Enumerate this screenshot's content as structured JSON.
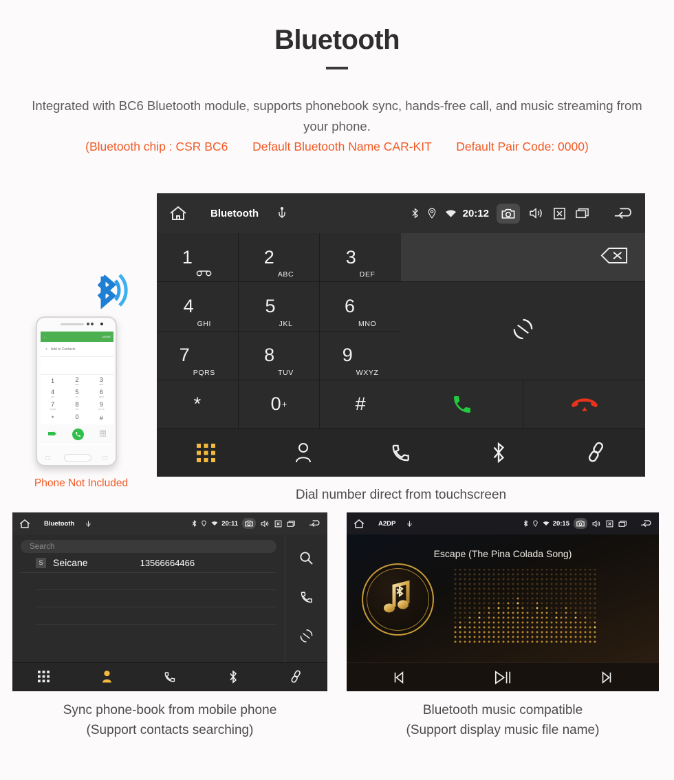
{
  "header": {
    "title": "Bluetooth",
    "description": "Integrated with BC6 Bluetooth module, supports phonebook sync, hands-free call, and music streaming from your phone.",
    "spec_chip": "(Bluetooth chip : CSR BC6",
    "spec_name": "Default Bluetooth Name CAR-KIT",
    "spec_pair": "Default Pair Code: 0000)",
    "accent_color": "#f15a24",
    "text_color": "#5c5c5c"
  },
  "phone_mock": {
    "note": "Phone Not Included",
    "screen": {
      "topbar_more": "MORE",
      "add_contacts": "Add to Contacts",
      "keys": [
        {
          "num": "1",
          "sub": ""
        },
        {
          "num": "2",
          "sub": "ABC"
        },
        {
          "num": "3",
          "sub": "DEF"
        },
        {
          "num": "4",
          "sub": "GHI"
        },
        {
          "num": "5",
          "sub": "JKL"
        },
        {
          "num": "6",
          "sub": "MNO"
        },
        {
          "num": "7",
          "sub": "PQRS"
        },
        {
          "num": "8",
          "sub": "TUV"
        },
        {
          "num": "9",
          "sub": "WXYZ"
        },
        {
          "num": "*",
          "sub": ""
        },
        {
          "num": "0",
          "sub": "+"
        },
        {
          "num": "#",
          "sub": ""
        }
      ]
    }
  },
  "dialer_unit": {
    "statusbar": {
      "home_icon": "home-icon",
      "title": "Bluetooth",
      "usb_icon": "usb-icon",
      "bluetooth_icon": "bluetooth-icon",
      "location_icon": "location-icon",
      "wifi_icon": "wifi-icon",
      "clock": "20:12",
      "camera_icon": "camera-icon",
      "volume_icon": "volume-icon",
      "close_icon": "close-box-icon",
      "recents_icon": "recents-icon",
      "back_icon": "back-icon"
    },
    "keys": [
      {
        "num": "1",
        "sub": "",
        "icon": "voicemail-icon"
      },
      {
        "num": "2",
        "sub": "ABC",
        "icon": ""
      },
      {
        "num": "3",
        "sub": "DEF",
        "icon": ""
      },
      {
        "num": "4",
        "sub": "GHI",
        "icon": ""
      },
      {
        "num": "5",
        "sub": "JKL",
        "icon": ""
      },
      {
        "num": "6",
        "sub": "MNO",
        "icon": ""
      },
      {
        "num": "7",
        "sub": "PQRS",
        "icon": ""
      },
      {
        "num": "8",
        "sub": "TUV",
        "icon": ""
      },
      {
        "num": "9",
        "sub": "WXYZ",
        "icon": ""
      },
      {
        "num": "*",
        "sub": "",
        "icon": ""
      },
      {
        "num": "0",
        "sub": "+",
        "icon": ""
      },
      {
        "num": "#",
        "sub": "",
        "icon": ""
      }
    ],
    "number_field_value": "",
    "backspace_icon": "backspace-icon",
    "sync_icon": "sync-icon",
    "call_icon": "call-icon",
    "hangup_icon": "hangup-icon",
    "call_color": "#22c93f",
    "hangup_color": "#e8321a",
    "nav": [
      {
        "name": "dialpad",
        "icon": "dialpad-icon",
        "active": true
      },
      {
        "name": "contacts",
        "icon": "contact-icon",
        "active": false
      },
      {
        "name": "call-log",
        "icon": "phone-icon",
        "active": false
      },
      {
        "name": "bluetooth",
        "icon": "bluetooth-icon",
        "active": false
      },
      {
        "name": "pair",
        "icon": "link-icon",
        "active": false
      }
    ],
    "active_color": "#f5b93e",
    "caption": "Dial number direct from touchscreen"
  },
  "phonebook_unit": {
    "statusbar": {
      "title": "Bluetooth",
      "clock": "20:11"
    },
    "search_placeholder": "Search",
    "contacts": [
      {
        "badge": "S",
        "name": "Seicane",
        "number": "13566664466"
      }
    ],
    "side_icons": [
      "search-icon",
      "phone-icon",
      "sync-icon"
    ],
    "nav_active": "contacts",
    "caption_line1": "Sync phone-book from mobile phone",
    "caption_line2": "(Support contacts searching)"
  },
  "music_unit": {
    "statusbar": {
      "title": "A2DP",
      "clock": "20:15"
    },
    "track_name": "Escape (The Pina Colada Song)",
    "logo_icon": "music-bluetooth-icon",
    "controls": [
      {
        "name": "previous",
        "icon": "prev-icon"
      },
      {
        "name": "play-pause",
        "icon": "play-pause-icon"
      },
      {
        "name": "next",
        "icon": "next-icon"
      }
    ],
    "gold_color": "#c79a37",
    "caption_line1": "Bluetooth music compatible",
    "caption_line2": "(Support display music file name)"
  }
}
